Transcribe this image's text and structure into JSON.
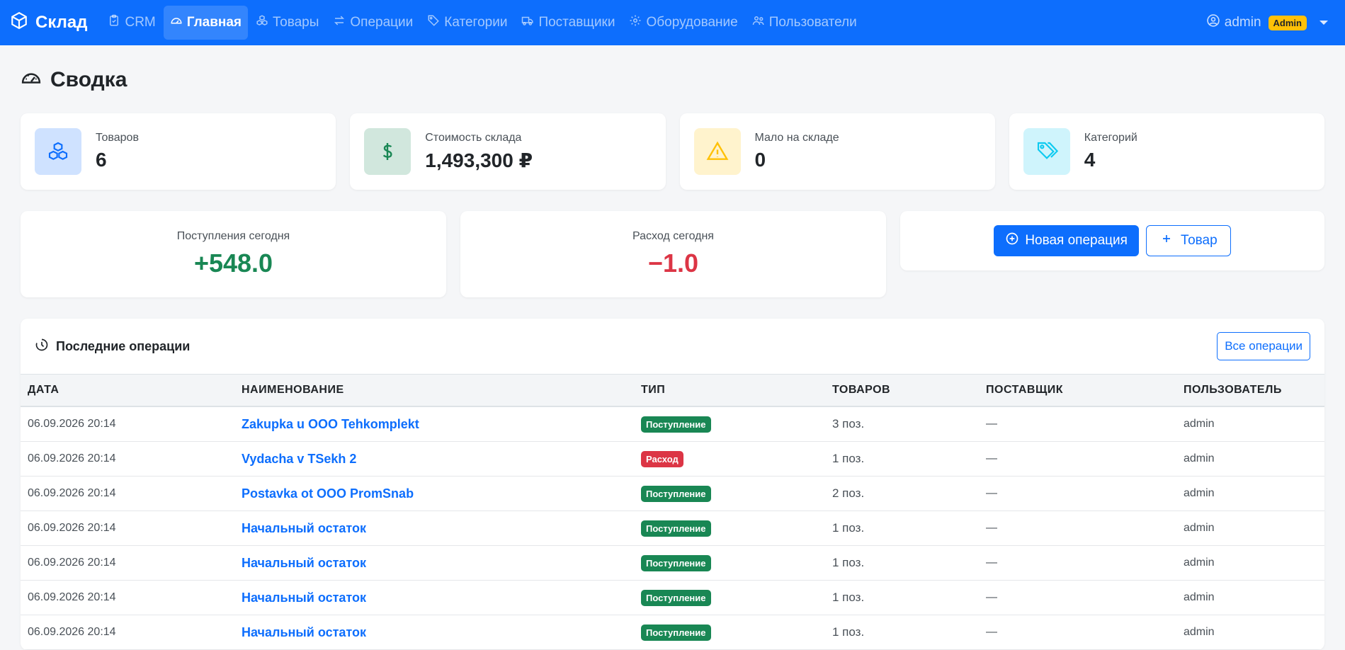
{
  "brand": "Склад",
  "nav": [
    {
      "label": "CRM",
      "icon": "clipboard-check-icon",
      "active": false
    },
    {
      "label": "Главная",
      "icon": "speedometer-icon",
      "active": true
    },
    {
      "label": "Товары",
      "icon": "boxes-icon",
      "active": false
    },
    {
      "label": "Операции",
      "icon": "arrow-left-right-icon",
      "active": false
    },
    {
      "label": "Категории",
      "icon": "tag-icon",
      "active": false
    },
    {
      "label": "Поставщики",
      "icon": "truck-icon",
      "active": false
    },
    {
      "label": "Оборудование",
      "icon": "gear-icon",
      "active": false
    },
    {
      "label": "Пользователи",
      "icon": "people-icon",
      "active": false
    }
  ],
  "user": {
    "name": "admin",
    "role": "Admin"
  },
  "page_title": "Сводка",
  "stats": [
    {
      "label": "Товаров",
      "value": "6",
      "icon": "boxes-icon",
      "bg": "#cfe2ff",
      "color": "#0d6efd"
    },
    {
      "label": "Стоимость склада",
      "value": "1,493,300 ₽",
      "icon": "dollar-icon",
      "bg": "#d1e7dd",
      "color": "#198754"
    },
    {
      "label": "Мало на складе",
      "value": "0",
      "icon": "warning-icon",
      "bg": "#fff3cd",
      "color": "#ffc107"
    },
    {
      "label": "Категорий",
      "value": "4",
      "icon": "tags-icon",
      "bg": "#cff4fc",
      "color": "#0dcaf0"
    }
  ],
  "today": {
    "income_label": "Поступления сегодня",
    "income_value": "+548.0",
    "expense_label": "Расход сегодня",
    "expense_value": "−1.0"
  },
  "actions": {
    "new_operation": "Новая операция",
    "add_product": "Товар"
  },
  "recent": {
    "title": "Последние операции",
    "all_button": "Все операции",
    "columns": [
      "Дата",
      "Наименование",
      "Тип",
      "Товаров",
      "Поставщик",
      "Пользователь"
    ],
    "rows": [
      {
        "date": "06.09.2026 20:14",
        "name": "Zakupka u OOO Tehkomplekt",
        "type": "Поступление",
        "kind": "in",
        "count": "3 поз.",
        "supplier": "—",
        "user": "admin"
      },
      {
        "date": "06.09.2026 20:14",
        "name": "Vydacha v TSekh 2",
        "type": "Расход",
        "kind": "out",
        "count": "1 поз.",
        "supplier": "—",
        "user": "admin"
      },
      {
        "date": "06.09.2026 20:14",
        "name": "Postavka ot OOO PromSnab",
        "type": "Поступление",
        "kind": "in",
        "count": "2 поз.",
        "supplier": "—",
        "user": "admin"
      },
      {
        "date": "06.09.2026 20:14",
        "name": "Начальный остаток",
        "type": "Поступление",
        "kind": "in",
        "count": "1 поз.",
        "supplier": "—",
        "user": "admin"
      },
      {
        "date": "06.09.2026 20:14",
        "name": "Начальный остаток",
        "type": "Поступление",
        "kind": "in",
        "count": "1 поз.",
        "supplier": "—",
        "user": "admin"
      },
      {
        "date": "06.09.2026 20:14",
        "name": "Начальный остаток",
        "type": "Поступление",
        "kind": "in",
        "count": "1 поз.",
        "supplier": "—",
        "user": "admin"
      },
      {
        "date": "06.09.2026 20:14",
        "name": "Начальный остаток",
        "type": "Поступление",
        "kind": "in",
        "count": "1 поз.",
        "supplier": "—",
        "user": "admin"
      }
    ]
  },
  "colors": {
    "primary": "#0d6efd",
    "success": "#198754",
    "danger": "#dc3545",
    "warning": "#ffc107"
  }
}
